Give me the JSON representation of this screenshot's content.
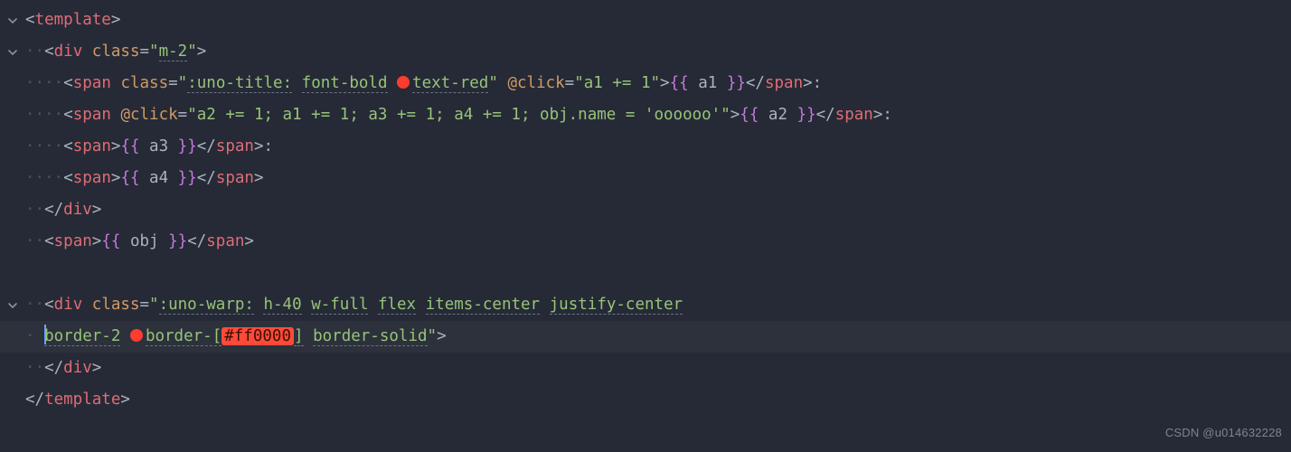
{
  "colors": {
    "bg": "#252a36",
    "tag": "#e06c75",
    "attr": "#d19a66",
    "string": "#98c379",
    "paren": "#c678dd",
    "hex_highlight_bg": "#ff4a3a",
    "swatch_red": "#ff3b30"
  },
  "watermark": "CSDN @u014632228",
  "lines": [
    {
      "fold": true,
      "indent": 0,
      "tokens": [
        {
          "t": "tag-b",
          "v": "<"
        },
        {
          "t": "tag",
          "v": "template"
        },
        {
          "t": "tag-b",
          "v": ">"
        }
      ]
    },
    {
      "fold": true,
      "indent": 1,
      "tokens": [
        {
          "t": "tag-b",
          "v": "<"
        },
        {
          "t": "tag",
          "v": "div"
        },
        {
          "t": "txt",
          "v": " "
        },
        {
          "t": "attr",
          "v": "class"
        },
        {
          "t": "eq",
          "v": "="
        },
        {
          "t": "str",
          "v": "\""
        },
        {
          "t": "str",
          "v": "m-2",
          "dashed": true
        },
        {
          "t": "str",
          "v": "\""
        },
        {
          "t": "tag-b",
          "v": ">"
        }
      ]
    },
    {
      "fold": false,
      "indent": 2,
      "tokens": [
        {
          "t": "tag-b",
          "v": "<"
        },
        {
          "t": "tag",
          "v": "span"
        },
        {
          "t": "txt",
          "v": " "
        },
        {
          "t": "attr",
          "v": "class"
        },
        {
          "t": "eq",
          "v": "="
        },
        {
          "t": "str",
          "v": "\""
        },
        {
          "t": "str",
          "v": ":uno-title:",
          "dashed": true
        },
        {
          "t": "str",
          "v": " "
        },
        {
          "t": "str",
          "v": "font-bold",
          "dashed": true
        },
        {
          "t": "str",
          "v": " "
        },
        {
          "t": "swatch"
        },
        {
          "t": "str",
          "v": "text-red",
          "dashed": true
        },
        {
          "t": "str",
          "v": "\""
        },
        {
          "t": "txt",
          "v": " "
        },
        {
          "t": "attr",
          "v": "@click"
        },
        {
          "t": "eq",
          "v": "="
        },
        {
          "t": "str",
          "v": "\"a1 += 1\""
        },
        {
          "t": "tag-b",
          "v": ">"
        },
        {
          "t": "paren",
          "v": "{{"
        },
        {
          "t": "txt",
          "v": " a1 "
        },
        {
          "t": "paren",
          "v": "}}"
        },
        {
          "t": "tag-b",
          "v": "</"
        },
        {
          "t": "tag",
          "v": "span"
        },
        {
          "t": "tag-b",
          "v": ">"
        },
        {
          "t": "txt",
          "v": ":"
        }
      ]
    },
    {
      "fold": false,
      "indent": 2,
      "tokens": [
        {
          "t": "tag-b",
          "v": "<"
        },
        {
          "t": "tag",
          "v": "span"
        },
        {
          "t": "txt",
          "v": " "
        },
        {
          "t": "attr",
          "v": "@click"
        },
        {
          "t": "eq",
          "v": "="
        },
        {
          "t": "str",
          "v": "\"a2 += 1; a1 += 1; a3 += 1; a4 += 1; obj.name = 'oooooo'\""
        },
        {
          "t": "tag-b",
          "v": ">"
        },
        {
          "t": "paren",
          "v": "{{"
        },
        {
          "t": "txt",
          "v": " a2 "
        },
        {
          "t": "paren",
          "v": "}}"
        },
        {
          "t": "tag-b",
          "v": "</"
        },
        {
          "t": "tag",
          "v": "span"
        },
        {
          "t": "tag-b",
          "v": ">"
        },
        {
          "t": "txt",
          "v": ":"
        }
      ]
    },
    {
      "fold": false,
      "indent": 2,
      "tokens": [
        {
          "t": "tag-b",
          "v": "<"
        },
        {
          "t": "tag",
          "v": "span"
        },
        {
          "t": "tag-b",
          "v": ">"
        },
        {
          "t": "paren",
          "v": "{{"
        },
        {
          "t": "txt",
          "v": " a3 "
        },
        {
          "t": "paren",
          "v": "}}"
        },
        {
          "t": "tag-b",
          "v": "</"
        },
        {
          "t": "tag",
          "v": "span"
        },
        {
          "t": "tag-b",
          "v": ">"
        },
        {
          "t": "txt",
          "v": ":"
        }
      ]
    },
    {
      "fold": false,
      "indent": 2,
      "tokens": [
        {
          "t": "tag-b",
          "v": "<"
        },
        {
          "t": "tag",
          "v": "span"
        },
        {
          "t": "tag-b",
          "v": ">"
        },
        {
          "t": "paren",
          "v": "{{"
        },
        {
          "t": "txt",
          "v": " a4 "
        },
        {
          "t": "paren",
          "v": "}}"
        },
        {
          "t": "tag-b",
          "v": "</"
        },
        {
          "t": "tag",
          "v": "span"
        },
        {
          "t": "tag-b",
          "v": ">"
        }
      ]
    },
    {
      "fold": false,
      "indent": 1,
      "tokens": [
        {
          "t": "tag-b",
          "v": "</"
        },
        {
          "t": "tag",
          "v": "div"
        },
        {
          "t": "tag-b",
          "v": ">"
        }
      ]
    },
    {
      "fold": false,
      "indent": 1,
      "tokens": [
        {
          "t": "tag-b",
          "v": "<"
        },
        {
          "t": "tag",
          "v": "span"
        },
        {
          "t": "tag-b",
          "v": ">"
        },
        {
          "t": "paren",
          "v": "{{"
        },
        {
          "t": "txt",
          "v": " obj "
        },
        {
          "t": "paren",
          "v": "}}"
        },
        {
          "t": "tag-b",
          "v": "</"
        },
        {
          "t": "tag",
          "v": "span"
        },
        {
          "t": "tag-b",
          "v": ">"
        }
      ]
    },
    {
      "fold": false,
      "indent": 0,
      "tokens": []
    },
    {
      "fold": true,
      "indent": 1,
      "tokens": [
        {
          "t": "tag-b",
          "v": "<"
        },
        {
          "t": "tag",
          "v": "div"
        },
        {
          "t": "txt",
          "v": " "
        },
        {
          "t": "attr",
          "v": "class"
        },
        {
          "t": "eq",
          "v": "="
        },
        {
          "t": "str",
          "v": "\""
        },
        {
          "t": "str",
          "v": ":uno-warp:",
          "dashed": true
        },
        {
          "t": "str",
          "v": " "
        },
        {
          "t": "str",
          "v": "h-40",
          "dashed": true
        },
        {
          "t": "str",
          "v": " "
        },
        {
          "t": "str",
          "v": "w-full",
          "dashed": true
        },
        {
          "t": "str",
          "v": " "
        },
        {
          "t": "str",
          "v": "flex",
          "dashed": true
        },
        {
          "t": "str",
          "v": " "
        },
        {
          "t": "str",
          "v": "items-center",
          "dashed": true
        },
        {
          "t": "str",
          "v": " "
        },
        {
          "t": "str",
          "v": "justify-center",
          "dashed": true
        }
      ]
    },
    {
      "fold": false,
      "active": true,
      "indent": 1,
      "wrap": true,
      "tokens": [
        {
          "t": "cursor"
        },
        {
          "t": "str",
          "v": "border-2",
          "dashed": true
        },
        {
          "t": "str",
          "v": " "
        },
        {
          "t": "swatch"
        },
        {
          "t": "str",
          "v": "border-[",
          "dashed": true
        },
        {
          "t": "hex",
          "v": "#ff0000"
        },
        {
          "t": "str",
          "v": "]",
          "dashed": true
        },
        {
          "t": "str",
          "v": " "
        },
        {
          "t": "str",
          "v": "border-solid",
          "dashed": true
        },
        {
          "t": "str",
          "v": "\""
        },
        {
          "t": "tag-b",
          "v": ">"
        }
      ]
    },
    {
      "fold": false,
      "indent": 1,
      "tokens": [
        {
          "t": "tag-b",
          "v": "</"
        },
        {
          "t": "tag",
          "v": "div"
        },
        {
          "t": "tag-b",
          "v": ">"
        }
      ]
    },
    {
      "fold": false,
      "indent": 0,
      "tokens": [
        {
          "t": "tag-b",
          "v": "</"
        },
        {
          "t": "tag",
          "v": "template"
        },
        {
          "t": "tag-b",
          "v": ">"
        }
      ]
    }
  ]
}
